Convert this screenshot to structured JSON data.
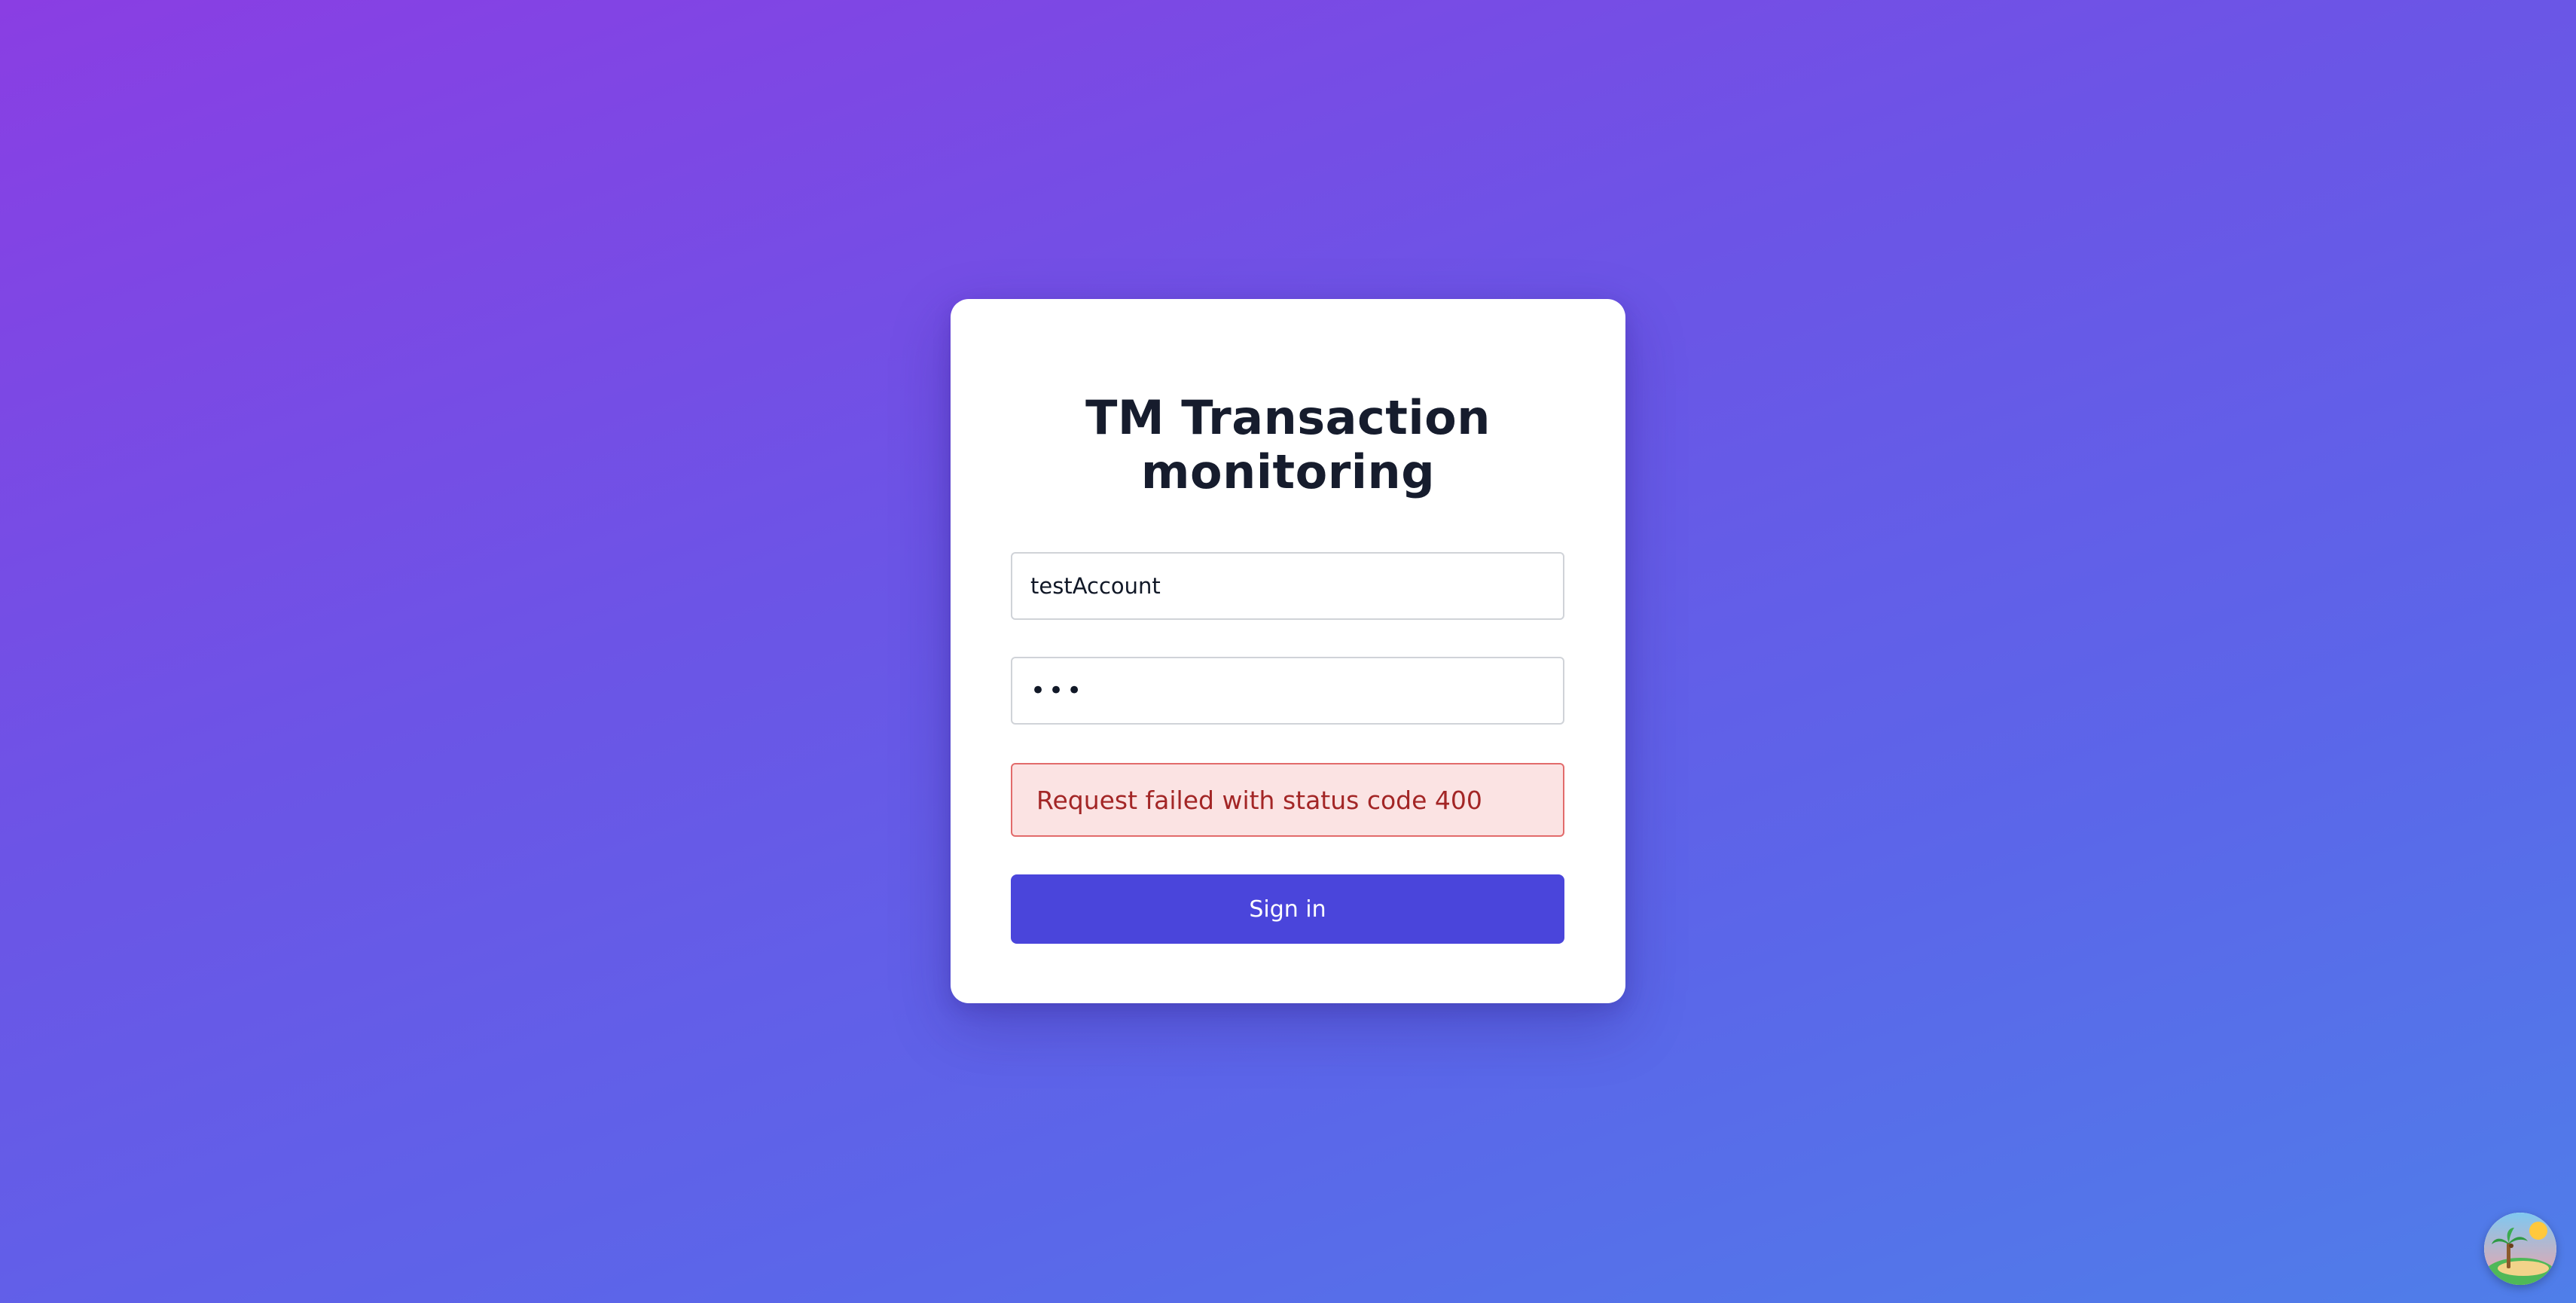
{
  "login": {
    "title": "TM Transaction monitoring",
    "username_value": "testAccount",
    "password_value": "abc",
    "error_message": "Request failed with status code 400",
    "signin_label": "Sign in"
  },
  "colors": {
    "primary_button": "#4a45db",
    "error_background": "#fbe3e3",
    "error_border": "#e26b6b",
    "error_text": "#a32626",
    "background_gradient_start": "#8a3ee3",
    "background_gradient_end": "#4f7ee9"
  },
  "corner_widget": {
    "icon": "beach-island-icon"
  }
}
